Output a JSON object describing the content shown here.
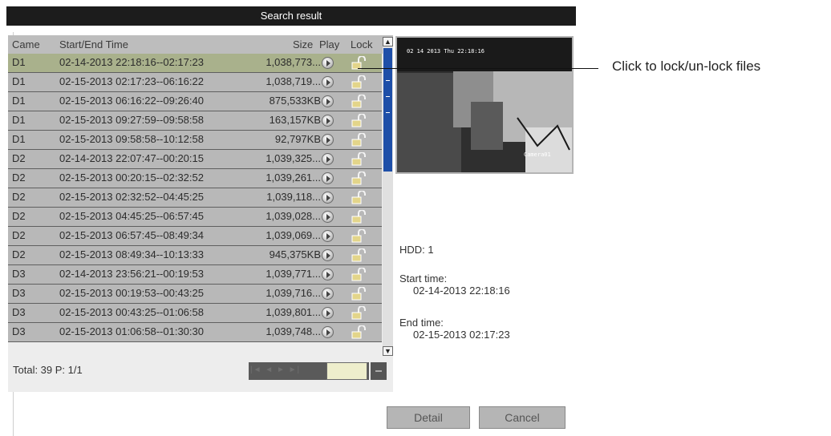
{
  "window": {
    "title": "Search result"
  },
  "table": {
    "headers": {
      "camera": "Came",
      "time": "Start/End Time",
      "size": "Size",
      "play": "Play",
      "lock": "Lock"
    },
    "rows": [
      {
        "camera": "D1",
        "time": "02-14-2013 22:18:16--02:17:23",
        "size": "1,038,773...",
        "selected": true
      },
      {
        "camera": "D1",
        "time": "02-15-2013 02:17:23--06:16:22",
        "size": "1,038,719..."
      },
      {
        "camera": "D1",
        "time": "02-15-2013 06:16:22--09:26:40",
        "size": "875,533KB"
      },
      {
        "camera": "D1",
        "time": "02-15-2013 09:27:59--09:58:58",
        "size": "163,157KB"
      },
      {
        "camera": "D1",
        "time": "02-15-2013 09:58:58--10:12:58",
        "size": "92,797KB"
      },
      {
        "camera": "D2",
        "time": "02-14-2013 22:07:47--00:20:15",
        "size": "1,039,325..."
      },
      {
        "camera": "D2",
        "time": "02-15-2013 00:20:15--02:32:52",
        "size": "1,039,261..."
      },
      {
        "camera": "D2",
        "time": "02-15-2013 02:32:52--04:45:25",
        "size": "1,039,118..."
      },
      {
        "camera": "D2",
        "time": "02-15-2013 04:45:25--06:57:45",
        "size": "1,039,028..."
      },
      {
        "camera": "D2",
        "time": "02-15-2013 06:57:45--08:49:34",
        "size": "1,039,069..."
      },
      {
        "camera": "D2",
        "time": "02-15-2013 08:49:34--10:13:33",
        "size": "945,375KB"
      },
      {
        "camera": "D3",
        "time": "02-14-2013 23:56:21--00:19:53",
        "size": "1,039,771..."
      },
      {
        "camera": "D3",
        "time": "02-15-2013 00:19:53--00:43:25",
        "size": "1,039,716..."
      },
      {
        "camera": "D3",
        "time": "02-15-2013 00:43:25--01:06:58",
        "size": "1,039,801..."
      },
      {
        "camera": "D3",
        "time": "02-15-2013 01:06:58--01:30:30",
        "size": "1,039,748..."
      }
    ]
  },
  "footer": {
    "total": "Total: 39  P: 1/1"
  },
  "preview": {
    "osd_timestamp": "02 14 2013 Thu 22:18:16",
    "osd_corner": "Camera01"
  },
  "info": {
    "hdd": "HDD: 1",
    "start_label": "Start time:",
    "start_value": "02-14-2013 22:18:16",
    "end_label": "End time:",
    "end_value": "02-15-2013 02:17:23"
  },
  "buttons": {
    "detail": "Detail",
    "cancel": "Cancel"
  },
  "callout": {
    "text": "Click to lock/un-lock files"
  },
  "colors": {
    "titlebar": "#1c1c1c",
    "row": "#b8b8b8",
    "row_selected": "#a9b18c",
    "scroll_thumb": "#1e4fa8"
  },
  "icons": {
    "play": "play-icon",
    "lock": "lock-icon"
  }
}
